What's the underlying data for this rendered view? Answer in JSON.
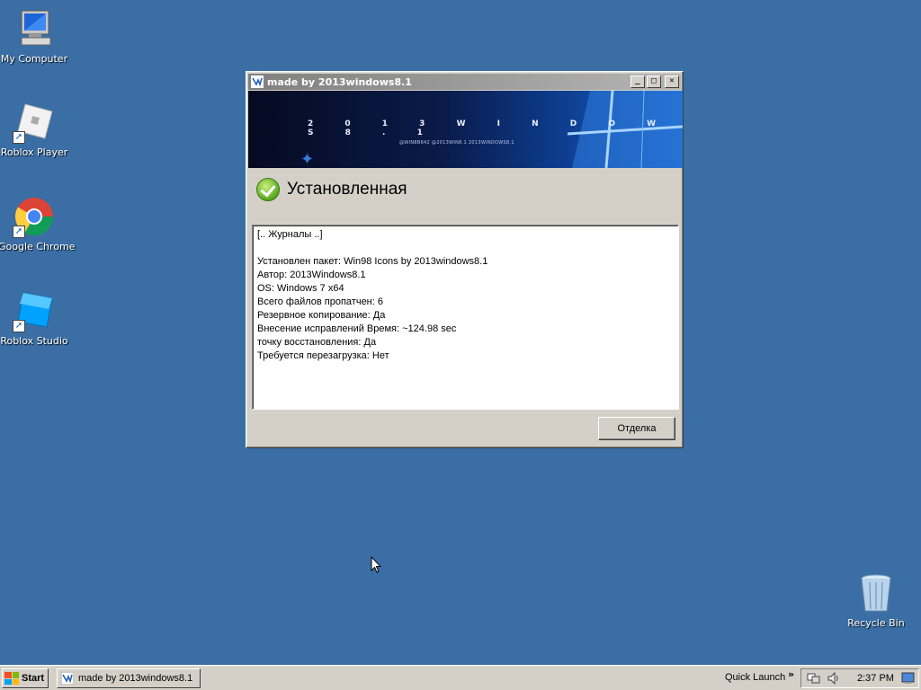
{
  "desktop": {
    "icons": [
      {
        "label": "My Computer",
        "icon": "my-computer-icon"
      },
      {
        "label": "Roblox Player",
        "icon": "roblox-player-icon"
      },
      {
        "label": "Google Chrome",
        "icon": "chrome-icon"
      },
      {
        "label": "Roblox Studio",
        "icon": "roblox-studio-icon"
      },
      {
        "label": "Recycle Bin",
        "icon": "recycle-bin-icon"
      }
    ]
  },
  "dialog": {
    "title": "made by 2013windows8.1",
    "banner_brand": "2 0 1 3 W I N D O W S 8 . 1",
    "banner_socials": "@WIN8B642   @2013WIN8.1   2013WINDOWS8.1",
    "status": "Установленная",
    "log_lines": [
      "[.. Журналы ..]",
      "",
      "Установлен пакет: Win98 Icons by 2013windows8.1",
      "Автор: 2013Windows8.1",
      "OS: Windows 7 x64",
      "Всего файлов пропатчен: 6",
      "Резервное копирование: Да",
      "Внесение исправлений Время: ~124.98 sec",
      "точку восстановления: Да",
      "Требуется перезагрузка: Нет"
    ],
    "cancel_label": "Отделка"
  },
  "taskbar": {
    "start_label": "Start",
    "task_label": "made by 2013windows8.1",
    "quick_launch_label": "Quick Launch",
    "chevron": "»",
    "clock": "2:37 PM"
  },
  "colors": {
    "desktop": "#3a6ea5",
    "face": "#d4d0c8",
    "title_start": "#808080",
    "title_end": "#b5b5b5"
  }
}
